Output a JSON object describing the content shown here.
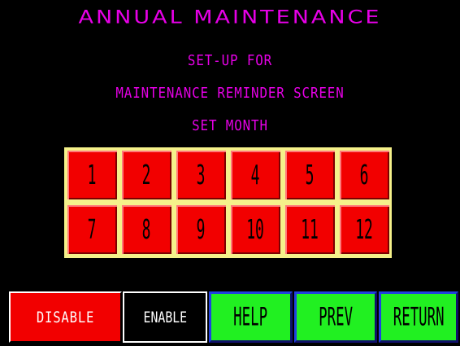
{
  "screen": {
    "title": "ANNUAL MAINTENANCE",
    "subtitle_lines": [
      "SET-UP FOR",
      "MAINTENANCE REMINDER SCREEN",
      "SET MONTH"
    ]
  },
  "months": [
    "1",
    "2",
    "3",
    "4",
    "5",
    "6",
    "7",
    "8",
    "9",
    "10",
    "11",
    "12"
  ],
  "buttons": {
    "disable": "DISABLE",
    "enable": "ENABLE",
    "help": "HELP",
    "prev": "PREV",
    "return": "RETURN"
  },
  "colors": {
    "background": "#000000",
    "title_text": "#e600e6",
    "month_button": "#f20000",
    "grid_frame": "#f5f18a",
    "disable_button": "#f20000",
    "nav_button": "#21f021",
    "nav_border": "#2040e0"
  }
}
